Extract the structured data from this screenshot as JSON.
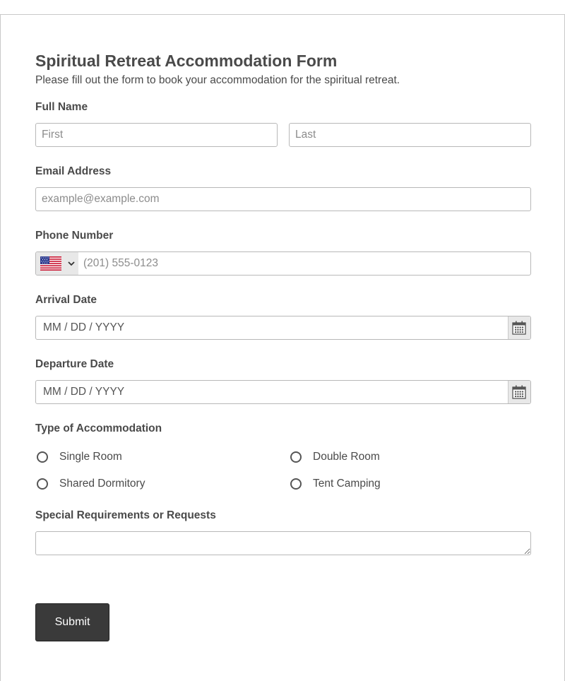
{
  "form": {
    "title": "Spiritual Retreat Accommodation Form",
    "subtitle": "Please fill out the form to book your accommodation for the spiritual retreat."
  },
  "full_name": {
    "label": "Full Name",
    "first_placeholder": "First",
    "last_placeholder": "Last"
  },
  "email": {
    "label": "Email Address",
    "placeholder": "example@example.com"
  },
  "phone": {
    "label": "Phone Number",
    "country_icon": "us-flag-icon",
    "placeholder": "(201) 555-0123"
  },
  "arrival": {
    "label": "Arrival Date",
    "placeholder": "MM / DD / YYYY",
    "icon": "calendar-icon"
  },
  "departure": {
    "label": "Departure Date",
    "placeholder": "MM / DD / YYYY",
    "icon": "calendar-icon"
  },
  "accommodation": {
    "label": "Type of Accommodation",
    "options": [
      "Single Room",
      "Double Room",
      "Shared Dormitory",
      "Tent Camping"
    ]
  },
  "requests": {
    "label": "Special Requirements or Requests"
  },
  "submit_label": "Submit",
  "colors": {
    "button_bg": "#3a3a3a",
    "label_text": "#4a4a4a",
    "input_border": "#b8b8b8"
  }
}
